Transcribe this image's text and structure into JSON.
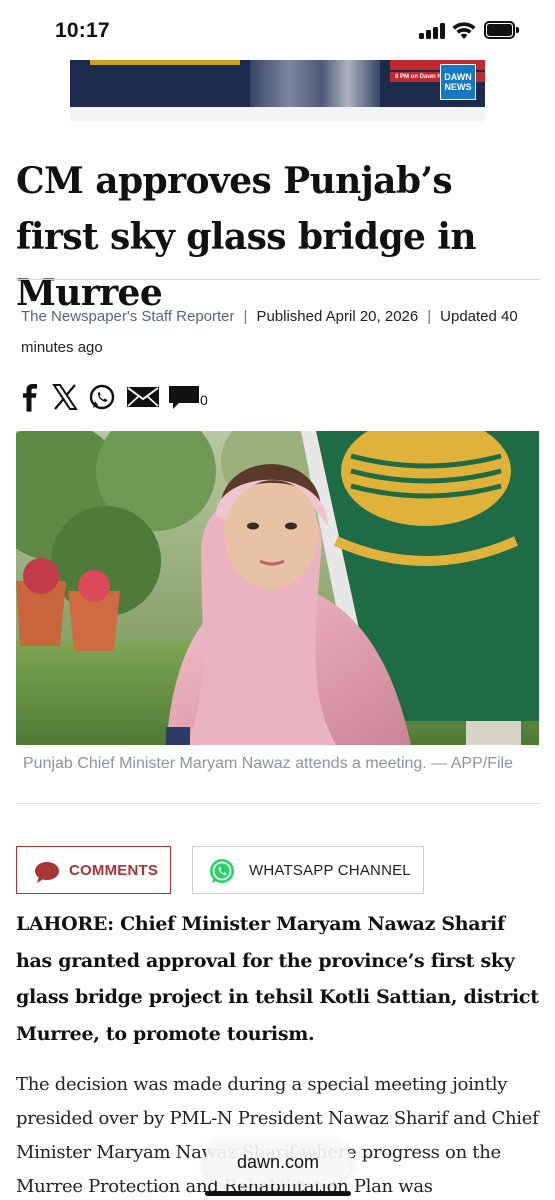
{
  "status_bar": {
    "time": "10:17",
    "icons": [
      "cellular-signal-icon",
      "wifi-icon",
      "battery-icon"
    ]
  },
  "ad_banner": {
    "text_line": "8 PM on Dawn News TV",
    "logo_text": "DAWN NEWS",
    "colors": {
      "background": "#1c2b4d",
      "accent_gold": "#c9a227",
      "accent_red": "#c0292f",
      "logo_blue": "#1578c2"
    }
  },
  "article": {
    "headline": "CM approves Punjab’s first sky glass bridge in Murree",
    "byline": {
      "author": "The Newspaper's Staff Reporter",
      "separator": "|",
      "published": "Published April 20, 2026",
      "updated": "Updated 40 minutes ago"
    },
    "share": {
      "icons": [
        "facebook-icon",
        "x-icon",
        "whatsapp-icon",
        "email-icon",
        "comment-icon"
      ],
      "comment_count": "0"
    },
    "photo": {
      "caption": "Punjab Chief Minister Maryam Nawaz attends a meeting. — APP/File"
    },
    "buttons": {
      "comments_label": "COMMENTS",
      "whatsapp_label": "WHATSAPP CHANNEL"
    },
    "lead": "LAHORE: Chief Minister Maryam Nawaz Sharif has granted approval for the province’s first sky glass bridge project in tehsil Kotli Sattian, district Murree, to promote tourism.",
    "paragraph": "The decision was made during a special meeting jointly presided over by PML-N President Nawaz Sharif and Chief Minister Maryam Nawaz Sharif where progress on the Murree Protection and Rehabilitation Plan was"
  },
  "browser": {
    "url": "dawn.com"
  },
  "colors": {
    "comments_red": "#a83535",
    "whatsapp_green": "#25d366",
    "byline_gray": "#5b6770",
    "caption_gray": "#8d959c"
  }
}
